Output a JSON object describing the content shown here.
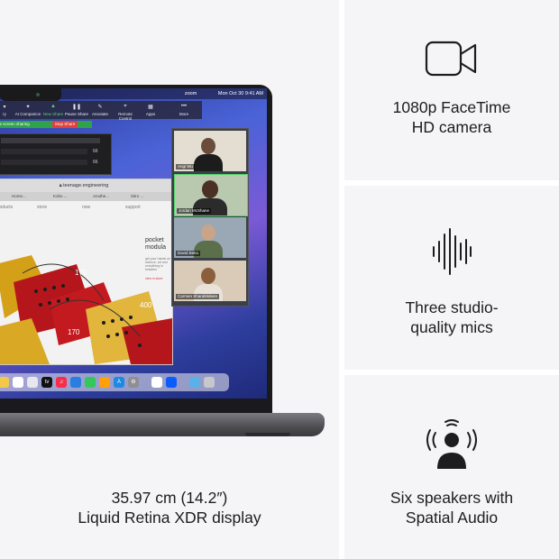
{
  "features": {
    "display": {
      "line1": "35.97 cm (14.2″)",
      "line2": "Liquid Retina XDR display"
    },
    "camera": {
      "line1": "1080p FaceTime",
      "line2": "HD camera",
      "icon": "video-camera-icon"
    },
    "mics": {
      "line1": "Three studio-",
      "line2": "quality mics",
      "icon": "waveform-icon"
    },
    "speakers": {
      "line1": "Six speakers with",
      "line2": "Spatial Audio",
      "icon": "spatial-audio-icon"
    }
  },
  "screen": {
    "menubar": {
      "app": "zoom",
      "clock": "Mon Oct 30 9:41 AM"
    },
    "zoom_toolbar": [
      "ry",
      "AI Companion",
      "New Share",
      "Pause Share",
      "Annotate",
      "Remote Control",
      "Apps",
      "More"
    ],
    "share_banner": "re screen sharing",
    "stop_share": "Stop Share",
    "dark_window_counts": [
      "66",
      "66"
    ],
    "browser": {
      "url": "teenage.engineering",
      "tabs": [
        "Home...",
        "Kobo ...",
        "Anothe...",
        "Sitro ..."
      ],
      "nav": [
        "products",
        "store",
        "now",
        "support"
      ],
      "pocket_title": [
        "pocket",
        "modula"
      ],
      "pocket_body": "get your hands on science, art and everything in between",
      "pocket_link": "view in store",
      "synth_labels": [
        "170",
        "400",
        "170"
      ]
    },
    "participants": [
      "Angi Wu",
      "Jordan McShane",
      "David Beko",
      "Carmen Sharafeldeen"
    ]
  },
  "colors": {
    "panel_bg": "#f5f5f7",
    "text": "#1d1d1f",
    "screen_accent": "#4a63d6",
    "zoom_green": "#2fa24a",
    "stop_red": "#e0413b"
  }
}
